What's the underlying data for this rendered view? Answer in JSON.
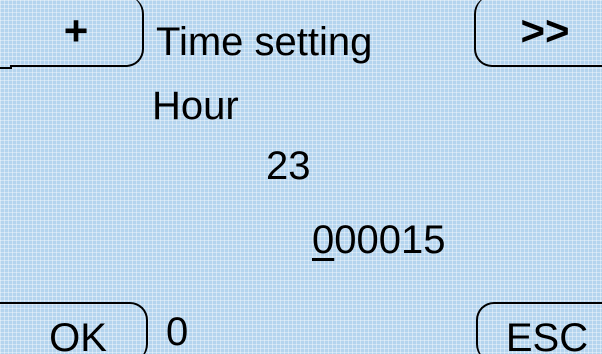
{
  "header": {
    "title": "Time setting",
    "left_softkey": "+",
    "right_softkey": ">>"
  },
  "parameter": {
    "name": "Hour",
    "number": "23",
    "value_cursor_digit": "0",
    "value_rest": "00015"
  },
  "footer": {
    "ok_softkey": "OK",
    "status_value": "0",
    "esc_softkey": "ESC"
  },
  "colors": {
    "screen_background": "#b4d4ee",
    "text": "#000000"
  }
}
